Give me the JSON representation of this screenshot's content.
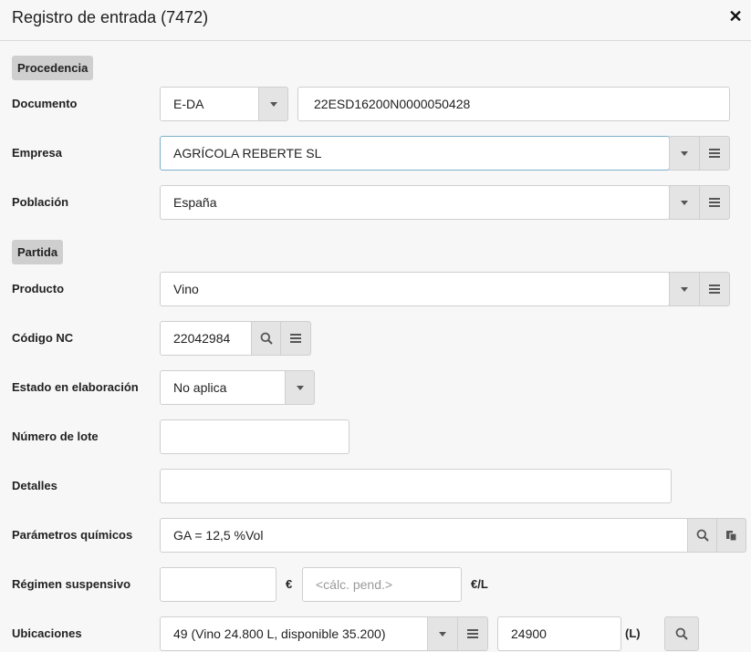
{
  "header": {
    "title": "Registro de entrada (7472)",
    "close": "✕"
  },
  "sections": {
    "procedencia": "Procedencia",
    "partida": "Partida"
  },
  "labels": {
    "documento": "Documento",
    "empresa": "Empresa",
    "poblacion": "Población",
    "producto": "Producto",
    "codigo_nc": "Código NC",
    "estado": "Estado en elaboración",
    "numero_lote": "Número de lote",
    "detalles": "Detalles",
    "parametros": "Parámetros químicos",
    "regimen": "Régimen suspensivo",
    "ubicaciones": "Ubicaciones"
  },
  "fields": {
    "documento_tipo": "E-DA",
    "documento_numero": "22ESD16200N0000050428",
    "empresa": "AGRÍCOLA REBERTE SL",
    "poblacion": "España",
    "producto": "Vino",
    "codigo_nc": "22042984",
    "estado": "No aplica",
    "numero_lote": "",
    "detalles": "",
    "parametros": "GA = 12,5 %Vol",
    "regimen_importe": "",
    "regimen_calc_placeholder": "<cálc. pend.>",
    "ubicacion": "49 (Vino 24.800 L, disponible 35.200)",
    "ubicacion_litros": "24900"
  },
  "units": {
    "euro": "€",
    "euro_litro": "€/L",
    "litros": "(L)"
  },
  "icons": {
    "dropdown": "caret-down-icon",
    "list": "list-icon",
    "search": "search-icon",
    "copy": "copy-icon",
    "close": "close-icon"
  },
  "colors": {
    "background": "#f7f7f7",
    "section_tag": "#cfcfcf",
    "button_bg": "#e4e4e4",
    "border": "#cfcfcf",
    "focus_border": "#7fb0cc"
  }
}
